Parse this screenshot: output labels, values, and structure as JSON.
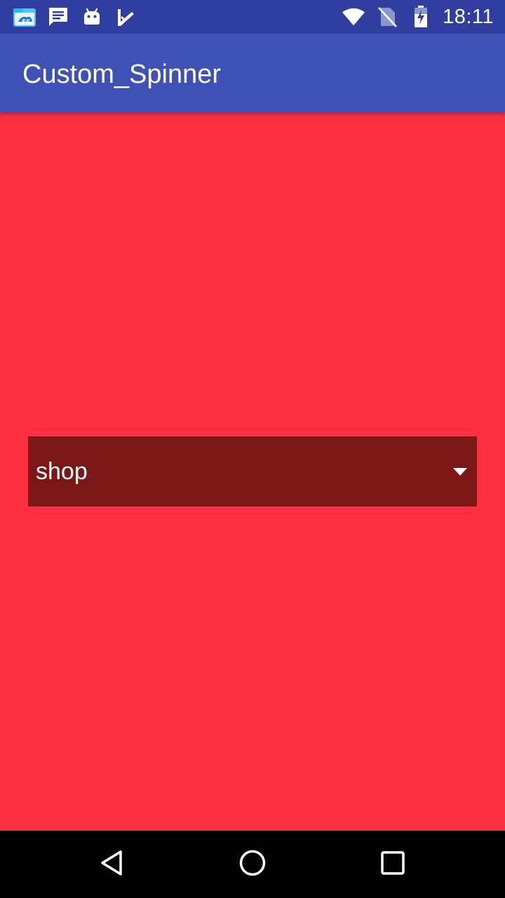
{
  "status_bar": {
    "notification_icons": [
      "file-manager-icon",
      "message-icon",
      "android-icon",
      "checkmark-app-icon"
    ],
    "system_icons": [
      "wifi-icon",
      "no-sim-icon",
      "battery-charging-icon"
    ],
    "time": "18:11"
  },
  "app_bar": {
    "title": "Custom_Spinner"
  },
  "spinner": {
    "selected_value": "shop",
    "icon": "dropdown-arrow-icon"
  },
  "nav_bar": {
    "icons": [
      "back-icon",
      "home-icon",
      "recents-icon"
    ]
  },
  "colors": {
    "status_bar": "#303f9f",
    "app_bar": "#3f51b5",
    "background": "#ff3042",
    "spinner_background": "#7c1717",
    "nav_bar": "#000000"
  }
}
